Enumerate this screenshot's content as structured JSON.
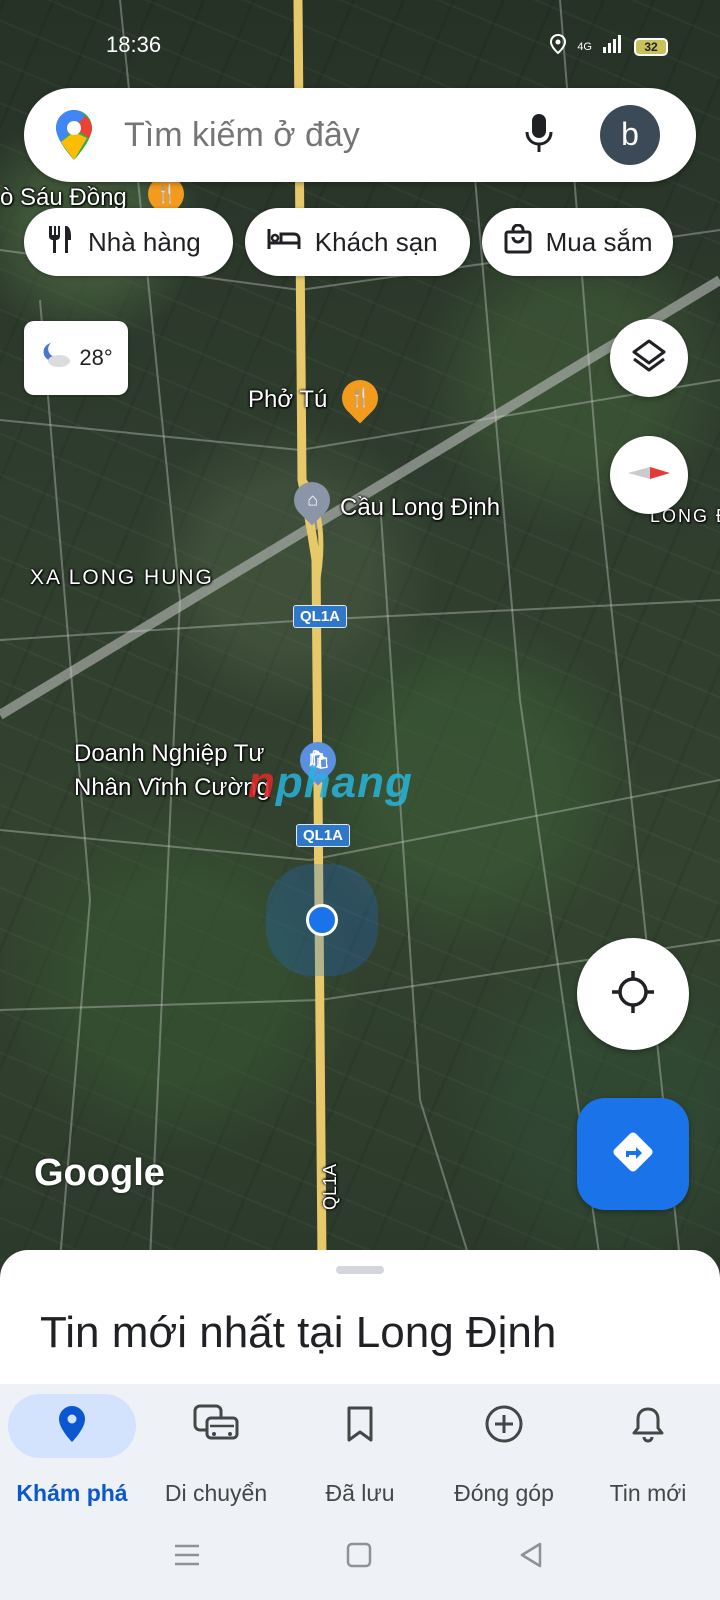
{
  "status_bar": {
    "time": "18:36",
    "battery": "32",
    "network": "4G"
  },
  "search": {
    "placeholder": "Tìm kiếm ở đây",
    "avatar_letter": "b"
  },
  "chips": [
    {
      "label": "Nhà hàng",
      "icon": "restaurant-icon"
    },
    {
      "label": "Khách sạn",
      "icon": "hotel-icon"
    },
    {
      "label": "Mua sắm",
      "icon": "shopping-bag-icon"
    }
  ],
  "weather": {
    "temp": "28°",
    "icon": "partly-cloudy-night-icon"
  },
  "map": {
    "labels": {
      "sau_dong": "ò Sáu Đồng",
      "pho_tu": "Phở Tú",
      "cau_long_dinh": "Cầu Long Định",
      "xa_long_hung": "XA LONG HUNG",
      "long_edge": "LONG Đ",
      "doanh_nghiep_1": "Doanh Nghiệp Tư",
      "doanh_nghiep_2": "Nhân Vĩnh Cường",
      "road_bottom": "QL1A"
    },
    "route_shields": [
      "QL1A",
      "QL1A"
    ],
    "watermark": {
      "red": "n",
      "blue": "phang"
    },
    "logo": "Google"
  },
  "sheet": {
    "title": "Tin mới nhất tại Long Định"
  },
  "bottom_nav": [
    {
      "label": "Khám phá",
      "icon": "explore-pin-icon",
      "active": true
    },
    {
      "label": "Di chuyển",
      "icon": "commute-icon",
      "active": false
    },
    {
      "label": "Đã lưu",
      "icon": "bookmark-icon",
      "active": false
    },
    {
      "label": "Đóng góp",
      "icon": "add-circle-icon",
      "active": false
    },
    {
      "label": "Tin mới",
      "icon": "bell-icon",
      "active": false
    }
  ],
  "colors": {
    "accent": "#1a73e8",
    "active_pill": "#d3e3fd",
    "active_label": "#0b57d0"
  }
}
